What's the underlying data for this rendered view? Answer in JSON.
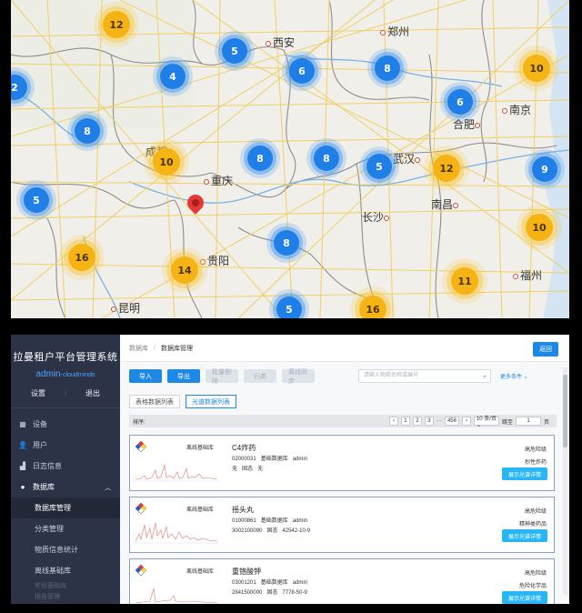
{
  "map": {
    "cities": [
      {
        "id": "xian",
        "name": "西安"
      },
      {
        "id": "zhengzhou",
        "name": "郑州"
      },
      {
        "id": "chengdu",
        "name": "成都"
      },
      {
        "id": "chongqing",
        "name": "重庆"
      },
      {
        "id": "wuhan",
        "name": "武汉"
      },
      {
        "id": "hefei",
        "name": "合肥"
      },
      {
        "id": "nanjing",
        "name": "南京"
      },
      {
        "id": "changsha",
        "name": "长沙"
      },
      {
        "id": "nanchang",
        "name": "南昌"
      },
      {
        "id": "guiyang",
        "name": "贵阳"
      },
      {
        "id": "fuzhou",
        "name": "福州"
      },
      {
        "id": "kunming",
        "name": "昆明"
      }
    ],
    "clusters": [
      {
        "count": "12",
        "color": "yellow"
      },
      {
        "count": "5",
        "color": "blue"
      },
      {
        "count": "4",
        "color": "blue"
      },
      {
        "count": "6",
        "color": "blue"
      },
      {
        "count": "8",
        "color": "blue"
      },
      {
        "count": "10",
        "color": "yellow"
      },
      {
        "count": "2",
        "color": "blue"
      },
      {
        "count": "6",
        "color": "blue"
      },
      {
        "count": "8",
        "color": "blue"
      },
      {
        "count": "10",
        "color": "yellow"
      },
      {
        "count": "8",
        "color": "blue"
      },
      {
        "count": "8",
        "color": "blue"
      },
      {
        "count": "5",
        "color": "blue"
      },
      {
        "count": "12",
        "color": "yellow"
      },
      {
        "count": "9",
        "color": "blue"
      },
      {
        "count": "5",
        "color": "blue"
      },
      {
        "count": "16",
        "color": "yellow"
      },
      {
        "count": "14",
        "color": "yellow"
      },
      {
        "count": "8",
        "color": "blue"
      },
      {
        "count": "10",
        "color": "yellow"
      },
      {
        "count": "11",
        "color": "yellow"
      },
      {
        "count": "5",
        "color": "blue"
      },
      {
        "count": "16",
        "color": "yellow"
      }
    ]
  },
  "sidebar": {
    "title": "拉曼租户平台管理系统",
    "user_main": "admin",
    "user_sub": "-cloudminds",
    "settings_label": "设置",
    "logout_label": "退出",
    "items": [
      {
        "label": "设备",
        "icon": "grid-icon"
      },
      {
        "label": "用户",
        "icon": "users-icon"
      },
      {
        "label": "日志信息",
        "icon": "chart-icon"
      },
      {
        "label": "数据库",
        "icon": "database-icon"
      }
    ],
    "subitems": [
      {
        "label": "数据库管理",
        "active": true
      },
      {
        "label": "分类管理",
        "active": false
      },
      {
        "label": "物质信息统计",
        "active": false
      },
      {
        "label": "离线基础库",
        "active": false
      }
    ],
    "faded": [
      "年份基础库",
      "报告管理"
    ]
  },
  "main": {
    "breadcrumb": [
      "数据库",
      "数据库管理"
    ],
    "back_label": "返回",
    "toolbar": [
      "导入",
      "导出",
      "批量删除",
      "归类",
      "离线同步"
    ],
    "search_placeholder": "请输入物质名称或编号",
    "more_label": "更多条件 ⌄",
    "tabs": [
      "表格数据列表",
      "光谱数据列表"
    ],
    "sort_label": "排序:",
    "pager": {
      "pages": [
        "‹",
        "1",
        "2",
        "3",
        "···",
        "456",
        "›"
      ],
      "page_size": "10 条/页 ⌄",
      "goto_label": "跳至",
      "goto_value": "1",
      "page_unit": "页"
    },
    "cards": [
      {
        "category": "离线基础库",
        "name": "C4炸药",
        "code": "02000031",
        "db": "基础数据库",
        "user": "admin",
        "extra1": "无",
        "state": "固态",
        "extra2": "无",
        "level": "高危险级",
        "type": "烈性炸药",
        "show": "展示光谱详情"
      },
      {
        "category": "离线基础库",
        "name": "摇头丸",
        "code": "01000861",
        "db": "基础数据库",
        "user": "admin",
        "extra1": "3002100090",
        "state": "固态",
        "extra2": "42542-10-9",
        "level": "高危险级",
        "type": "精神类药品",
        "show": "展示光谱详情"
      },
      {
        "category": "离线基础库",
        "name": "重铬酸钾",
        "code": "03001201",
        "db": "基础数据库",
        "user": "admin",
        "extra1": "2841500000",
        "state": "固态",
        "extra2": "7778-50-9",
        "level": "高危险级",
        "type": "危险化学品",
        "show": "展示光谱详情"
      }
    ]
  }
}
